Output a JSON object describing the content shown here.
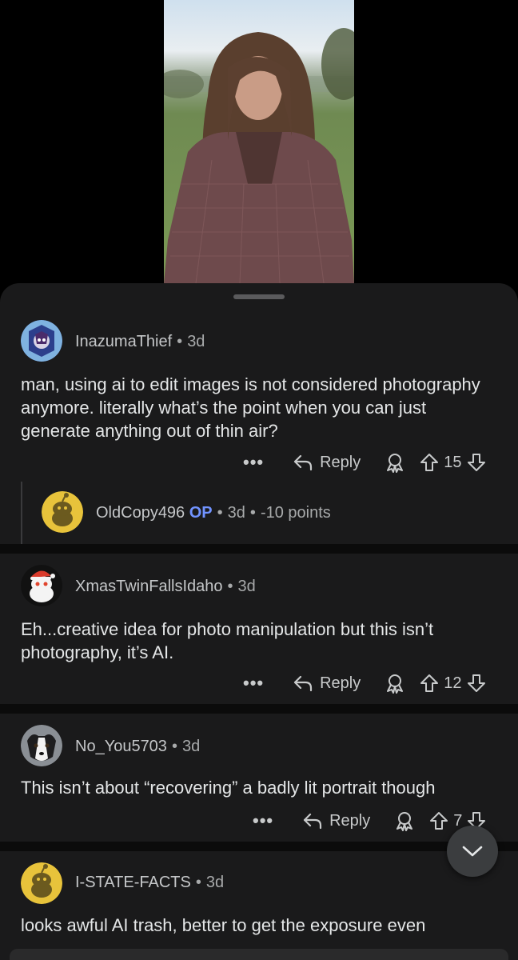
{
  "colors": {
    "background": "#1a1a1b",
    "op_badge": "#7193ff",
    "snoo_yellow": "#e8c33b"
  },
  "comments": [
    {
      "username": "InazumaThief",
      "age": "3d",
      "avatar_icon": "character-avatar-icon",
      "text": "man, using ai to edit images is not considered photography anymore. literally what’s the point when you can just generate anything out of thin air?",
      "more": "•••",
      "reply_label": "Reply",
      "score": "15"
    },
    {
      "username": "OldCopy496",
      "op_label": "OP",
      "age": "3d",
      "score_text": "-10 points",
      "avatar_icon": "snoo-yellow-avatar-icon"
    },
    {
      "username": "XmasTwinFallsIdaho",
      "age": "3d",
      "avatar_icon": "snoo-santa-avatar-icon",
      "text": "Eh...creative idea for photo manipulation but this isn’t photography, it’s AI.",
      "more": "•••",
      "reply_label": "Reply",
      "score": "12"
    },
    {
      "username": "No_You5703",
      "age": "3d",
      "avatar_icon": "dog-photo-avatar-icon",
      "text": "This isn’t about “recovering” a badly lit portrait though",
      "more": "•••",
      "reply_label": "Reply",
      "score": "7"
    },
    {
      "username": "I-STATE-FACTS",
      "age": "3d",
      "avatar_icon": "snoo-yellow-avatar-icon",
      "text": "looks awful AI trash, better to get the exposure even"
    }
  ],
  "separator": "•"
}
